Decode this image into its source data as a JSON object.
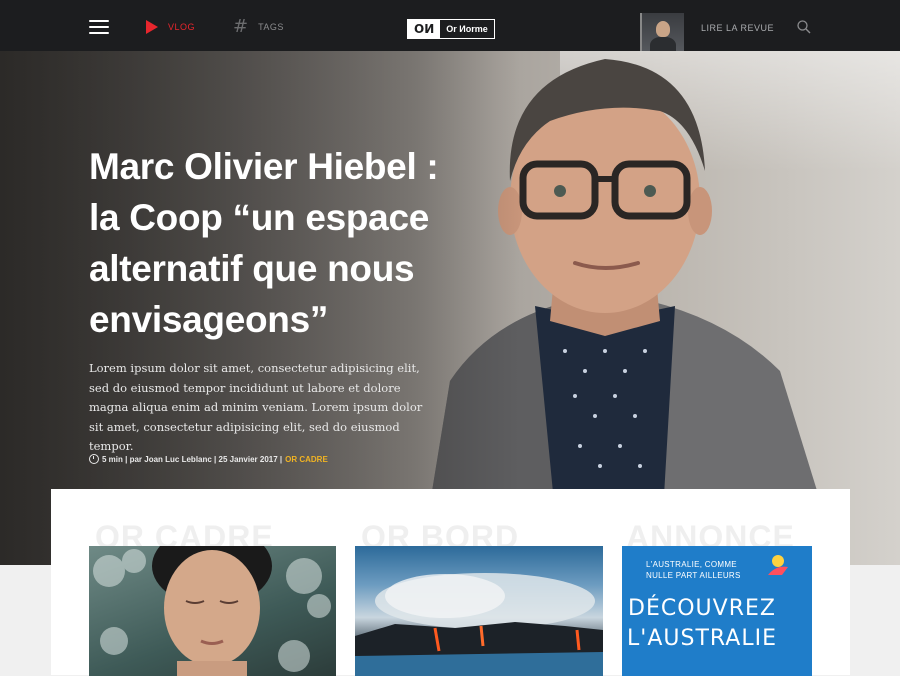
{
  "nav": {
    "vlog_label": "VLOG",
    "tags_label": "TAGS",
    "logo_mark": "OИ",
    "logo_text": "Or Иorme",
    "revue_label": "LIRE LA REVUE"
  },
  "hero": {
    "title": "Marc Olivier Hiebel : la Coop “un espace alternatif que nous envisageons”",
    "description": "Lorem ipsum dolor sit amet, consectetur adipisicing elit, sed do eiusmod tempor incididunt ut labore et dolore magna aliqua enim ad minim veniam. Lorem ipsum dolor sit amet, consectetur adipisicing elit, sed do eiusmod tempor.",
    "meta": "5 min | par Joan Luc Leblanc | 25 Janvier 2017 |",
    "category": "OR CADRE"
  },
  "sections": [
    {
      "title": "OR CADRE"
    },
    {
      "title": "OR BORD"
    },
    {
      "title": "ANNONCE"
    }
  ],
  "ad": {
    "line1": "L'AUSTRALIE, COMME",
    "line2": "NULLE PART AILLEURS",
    "big1": "DÉCOUVREZ",
    "big2": "L'AUSTRALIE"
  },
  "colors": {
    "nav_bg": "#1c1d1f",
    "accent_red": "#e8262d",
    "accent_gold": "#f0b323",
    "ad_blue": "#1f7dc9"
  }
}
